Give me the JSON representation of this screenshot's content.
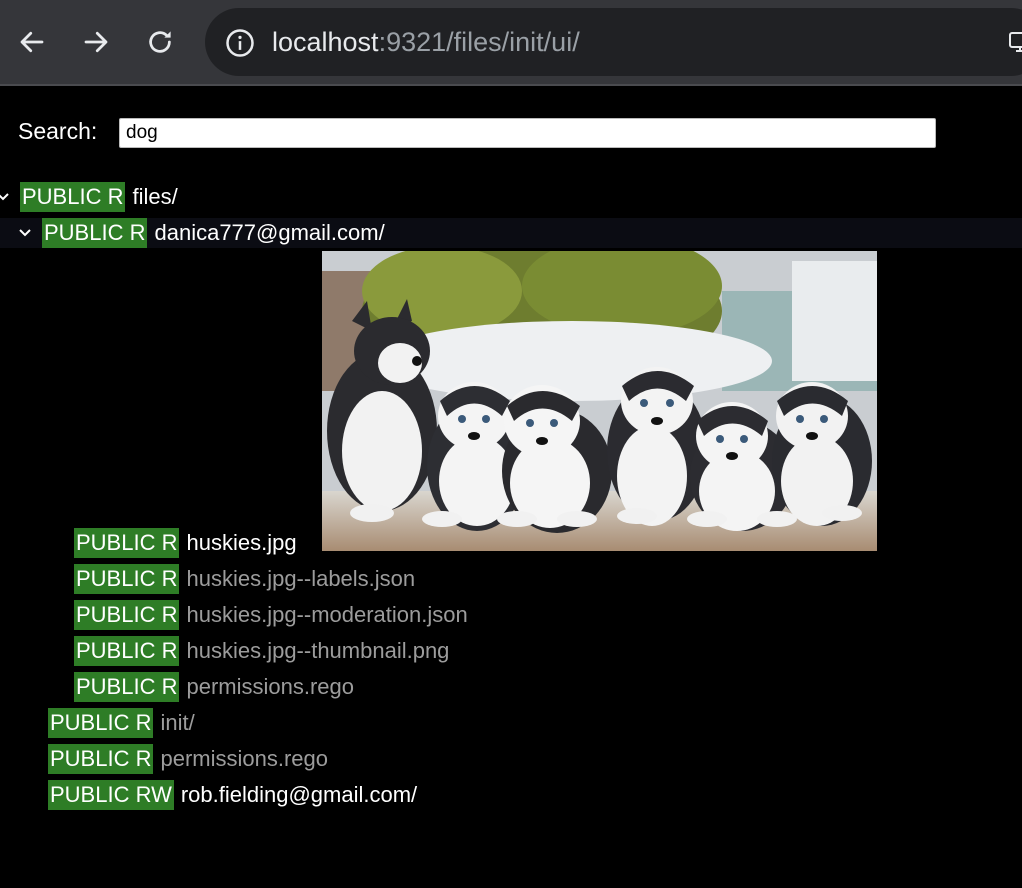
{
  "browser": {
    "url_host": "localhost",
    "url_rest": ":9321/files/init/ui/",
    "icons": [
      "back-arrow-icon",
      "forward-arrow-icon",
      "reload-icon",
      "info-icon",
      "cast-icon"
    ]
  },
  "search": {
    "label": "Search:",
    "value": "dog"
  },
  "tree": {
    "root": {
      "badge": "PUBLIC R",
      "name": "files/"
    },
    "user1": {
      "badge": "PUBLIC R",
      "name": "danica777@gmail.com/"
    },
    "items": [
      {
        "badge": "PUBLIC R",
        "name": "huskies.jpg"
      },
      {
        "badge": "PUBLIC R",
        "name": "huskies.jpg--labels.json"
      },
      {
        "badge": "PUBLIC R",
        "name": "huskies.jpg--moderation.json"
      },
      {
        "badge": "PUBLIC R",
        "name": "huskies.jpg--thumbnail.png"
      },
      {
        "badge": "PUBLIC R",
        "name": "permissions.rego"
      }
    ],
    "init": {
      "badge": "PUBLIC R",
      "name": "init/"
    },
    "perm": {
      "badge": "PUBLIC R",
      "name": "permissions.rego"
    },
    "user2": {
      "badge": "PUBLIC RW",
      "name": "rob.fielding@gmail.com/"
    }
  },
  "colors": {
    "badge_bg": "#2e7d26",
    "dim_text": "#9c9c9c",
    "toolbar_bg": "#35363a"
  }
}
